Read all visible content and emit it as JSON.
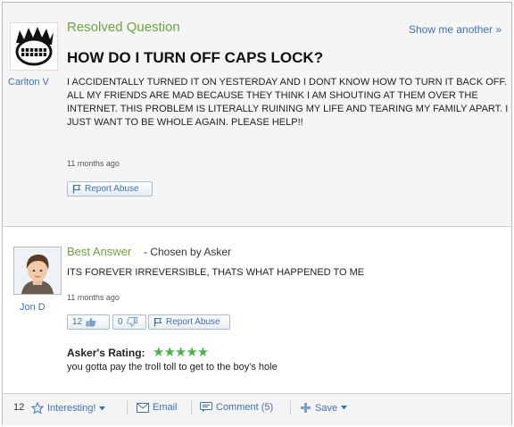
{
  "question": {
    "status": "Resolved Question",
    "show_another": "Show me another »",
    "asker": "Carlton V",
    "title": "HOW DO I TURN OFF CAPS LOCK?",
    "body": "I ACCIDENTALLY TURNED IT ON YESTERDAY AND I DONT KNOW HOW TO TURN IT BACK OFF. ALL MY FRIENDS ARE MAD BECAUSE THEY THINK I AM SHOUTING AT THEM OVER THE INTERNET. THIS PROBLEM IS LITERALLY RUINING MY LIFE AND TEARING MY FAMILY APART. I JUST WANT TO BE WHOLE AGAIN. PLEASE HELP!!",
    "time": "11 months ago",
    "report": "Report Abuse"
  },
  "answer": {
    "label": "Best Answer",
    "chosen": "- Chosen by Asker",
    "answerer": "Jon D",
    "body": "ITS FOREVER IRREVERSIBLE, THATS WHAT HAPPENED TO ME",
    "time": "11 months ago",
    "thumbs_up": "12",
    "thumbs_down": "0",
    "report": "Report Abuse",
    "rating_label": "Asker's Rating:",
    "stars": "★★★★★",
    "rating_comment": "you gotta pay the troll toll to get to the boy's hole"
  },
  "footer": {
    "interesting_count": "12",
    "interesting": "Interesting!",
    "email": "Email",
    "comment": "Comment (5)",
    "save": "Save"
  },
  "colors": {
    "green": "#6aa63a",
    "link": "#3a72b5",
    "star": "#4bb34b"
  }
}
